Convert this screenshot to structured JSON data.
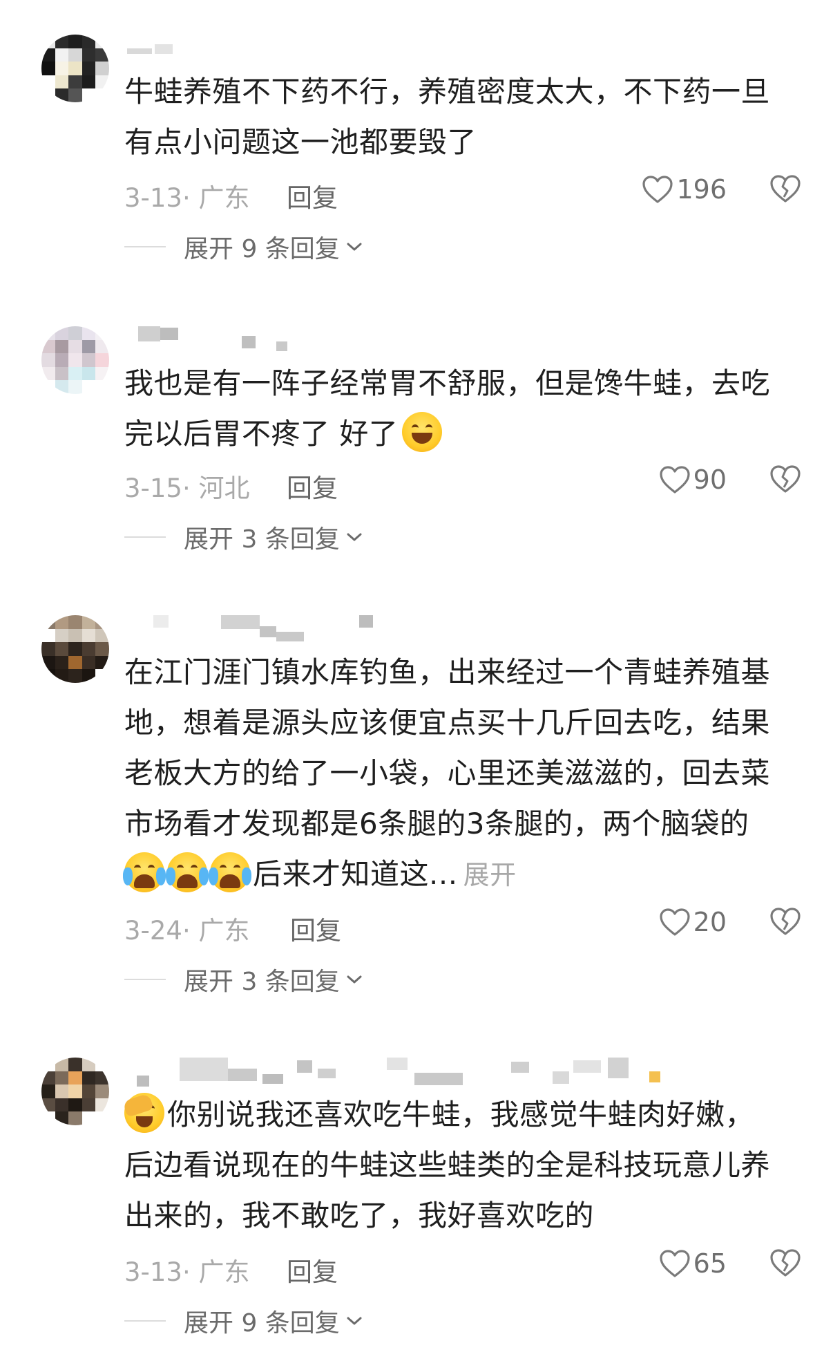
{
  "comments": [
    {
      "lines": [
        "牛蛙养殖不下药不行，养殖密度太大，不下药一旦",
        "有点小问题这一池都要毁了"
      ],
      "date": "3-13· 广东",
      "reply_label": "回复",
      "likes": "196",
      "expand_label": "展开 9 条回复"
    },
    {
      "lines": [
        "我也是有一阵子经常胃不舒服，但是馋牛蛙，去吃",
        "完以后胃不疼了 好了"
      ],
      "date": "3-15· 河北",
      "reply_label": "回复",
      "likes": "90",
      "expand_label": "展开 3 条回复"
    },
    {
      "lines": [
        "在江门涯门镇水库钓鱼，出来经过一个青蛙养殖基",
        "地，想着是源头应该便宜点买十几斤回去吃，结果",
        "老板大方的给了一小袋，心里还美滋滋的，回去菜",
        "市场看才发现都是6条腿的3条腿的，两个脑袋的",
        "后来才知道这..."
      ],
      "more_link": "展开",
      "date": "3-24· 广东",
      "reply_label": "回复",
      "likes": "20",
      "expand_label": "展开 3 条回复"
    },
    {
      "lines": [
        "你别说我还喜欢吃牛蛙，我感觉牛蛙肉好嫩，",
        "后边看说现在的牛蛙这些蛙类的全是科技玩意儿养",
        "出来的，我不敢吃了，我好喜欢吃的"
      ],
      "date": "3-13· 广东",
      "reply_label": "回复",
      "likes": "65",
      "expand_label": "展开 9 条回复"
    }
  ],
  "icons": {
    "like": "heart-outline-icon",
    "dislike": "broken-heart-icon",
    "chevron": "chevron-down-icon",
    "grin_emoji": "grinning-emoji",
    "cry_emoji": "loudly-crying-emoji",
    "facepalm_emoji": "facepalm-emoji"
  }
}
